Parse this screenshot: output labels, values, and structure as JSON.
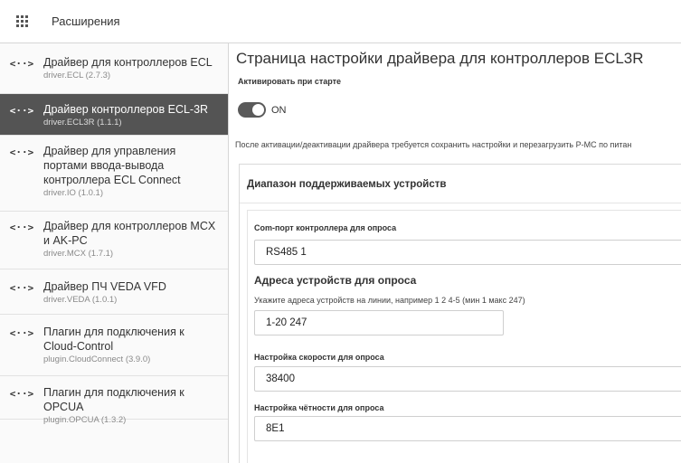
{
  "topbar": {
    "title": "Расширения",
    "menu_icon": "apps-grid-icon"
  },
  "sidebar": {
    "items": [
      {
        "label": "Драйвер для контроллеров ECL",
        "sub": "driver.ECL (2.7.3)",
        "icon": "<··>"
      },
      {
        "label": "Драйвер контроллеров ECL-3R",
        "sub": "driver.ECL3R (1.1.1)",
        "icon": "<··>"
      },
      {
        "label": "Драйвер для управления портами ввода-вывода контроллера ECL Connect",
        "sub": "driver.IO (1.0.1)",
        "icon": "<··>"
      },
      {
        "label": "Драйвер для контроллеров MCX и AK-PC",
        "sub": "driver.MCX (1.7.1)",
        "icon": "<··>"
      },
      {
        "label": "Драйвер ПЧ VEDA VFD",
        "sub": "driver.VEDA (1.0.1)",
        "icon": "<··>"
      },
      {
        "label": "Плагин для подключения к Cloud-Control",
        "sub": "plugin.CloudConnect (3.9.0)",
        "icon": "<··>"
      },
      {
        "label": "Плагин для подключения к OPCUA",
        "sub": "plugin.OPCUA (1.3.2)",
        "icon": "<··>"
      }
    ]
  },
  "main": {
    "title": "Страница настройки драйвера для контроллеров ECL3R",
    "autostart_label": "Активировать при старте",
    "toggle_state": "ON",
    "notice": "После активации/деактивации драйвера требуется сохранить настройки и перезагрузить P-MC по питан",
    "card": {
      "title": "Диапазон поддерживаемых устройств",
      "com_port_label": "Com-порт контроллера для опроса",
      "com_port_value": "RS485 1",
      "addresses_heading": "Адреса устройств для опроса",
      "addresses_hint": "Укажите адреса устройств на линии, например 1 2 4-5 (мин 1 макс 247)",
      "addresses_value": "1-20 247",
      "speed_label": "Настройка скорости для опроса",
      "speed_value": "38400",
      "parity_label": "Настройка чётности для опроса",
      "parity_value": "8E1"
    }
  }
}
